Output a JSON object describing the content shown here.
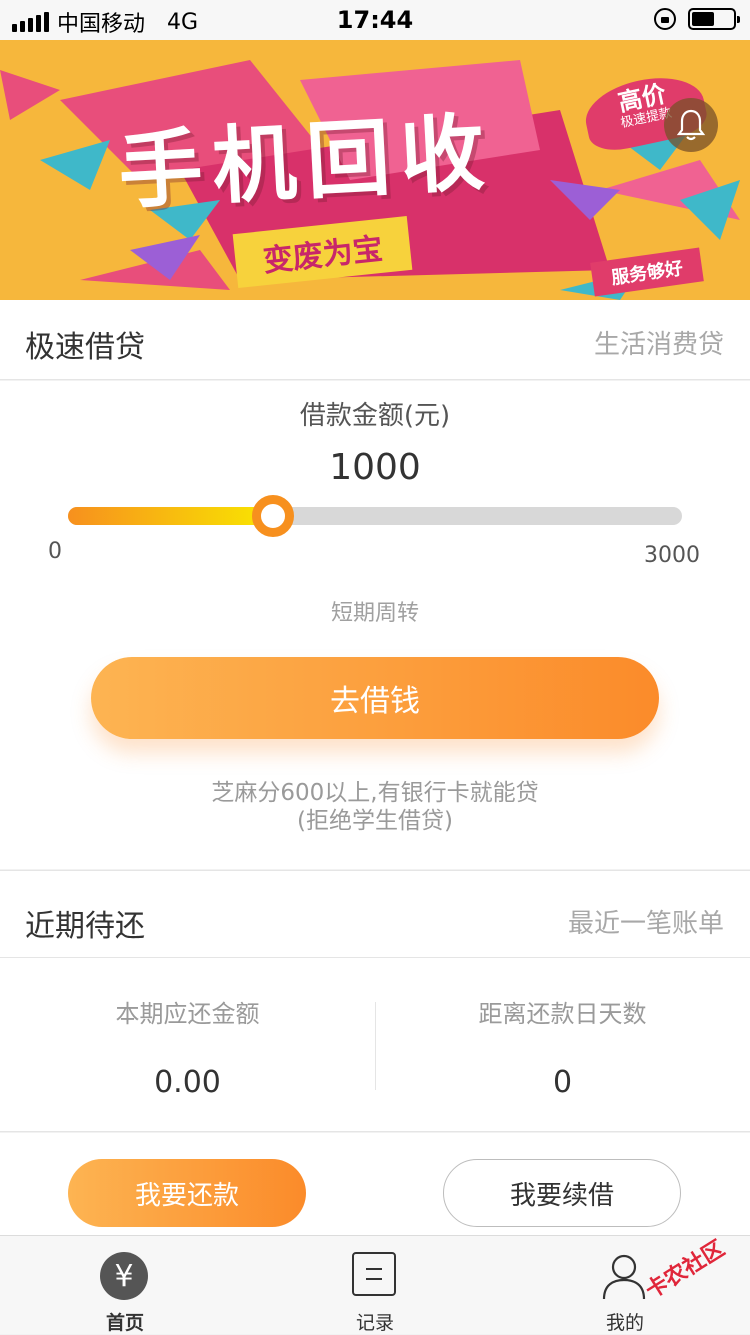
{
  "status_bar": {
    "carrier": "中国移动",
    "network": "4G",
    "time": "17:44"
  },
  "banner": {
    "title": "手机回收",
    "subtitle": "变废为宝",
    "badge": "高价",
    "badge_small": "极速提款",
    "service_tag": "服务够好",
    "active_dot": 1,
    "dot_colors": [
      "#c9c9c9",
      "#ffffff"
    ]
  },
  "loan": {
    "section_title": "极速借贷",
    "section_extra": "生活消费贷",
    "amount_label": "借款金额(元)",
    "amount_value": "1000",
    "slider_min": "0",
    "slider_max": "3000",
    "slider_value": 1000,
    "term": "短期周转",
    "borrow_button": "去借钱",
    "note_line1": "芝麻分600以上,有银行卡就能贷",
    "note_line2": "(拒绝学生借贷)"
  },
  "repay": {
    "section_title": "近期待还",
    "section_extra": "最近一笔账单",
    "due_amount_label": "本期应还金额",
    "due_amount_value": "0.00",
    "days_label": "距离还款日天数",
    "days_value": "0",
    "repay_button": "我要还款",
    "renew_button": "我要续借"
  },
  "tab_bar": {
    "tabs": [
      {
        "label": "首页",
        "icon": "yen-icon",
        "glyph": "¥",
        "active": true
      },
      {
        "label": "记录",
        "icon": "records-icon",
        "active": false
      },
      {
        "label": "我的",
        "icon": "user-icon",
        "active": false
      }
    ]
  },
  "watermark": "卡农社区",
  "colors": {
    "accent": "#fb8b2a",
    "accent_light": "#fdb452",
    "banner_bg": "#f6b73c"
  }
}
